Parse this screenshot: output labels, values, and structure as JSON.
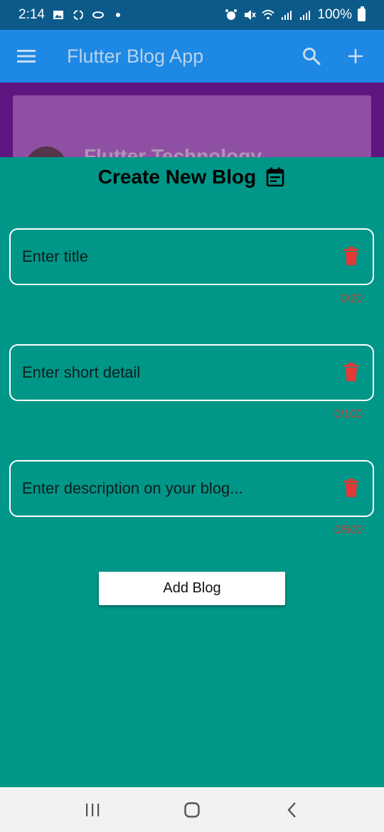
{
  "status_bar": {
    "time": "2:14",
    "battery": "100%",
    "left_icons": [
      "gallery-icon",
      "sync-icon",
      "link-icon",
      "dot-icon"
    ],
    "right_icons": [
      "alarm-icon",
      "mute-icon",
      "wifi-icon",
      "signal-icon",
      "signal-icon",
      "battery-icon"
    ]
  },
  "app_bar": {
    "title": "Flutter Blog App",
    "icons": [
      "menu-icon",
      "search-icon",
      "add-icon"
    ],
    "color": "#1e88e5"
  },
  "background_card": {
    "title": "Flutter Technology"
  },
  "sheet": {
    "title": "Create New Blog",
    "title_icon": "calendar-icon",
    "color": "#009688",
    "fields": [
      {
        "placeholder": "Enter title",
        "value": "",
        "counter": "0/20"
      },
      {
        "placeholder": "Enter short detail",
        "value": "",
        "counter": "0/100"
      },
      {
        "placeholder": "Enter description on your blog...",
        "value": "",
        "counter": "0/500"
      }
    ],
    "submit_label": "Add Blog",
    "trash_color": "#e53935",
    "counter_color": "#d44033"
  },
  "nav_bar": {
    "icons": [
      "recent-apps-icon",
      "home-icon",
      "back-icon"
    ]
  }
}
